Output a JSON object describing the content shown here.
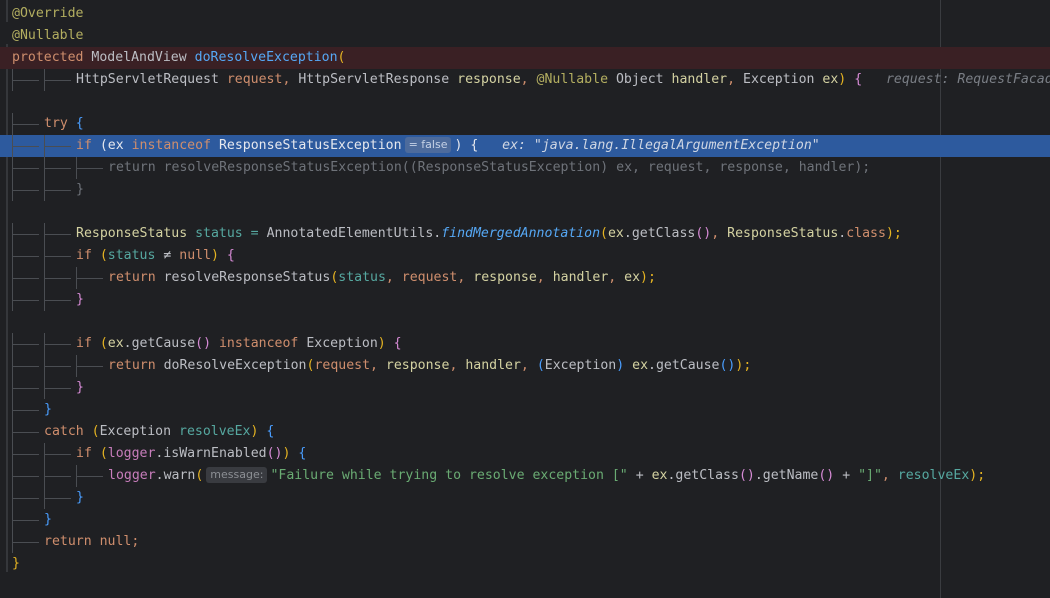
{
  "editor": {
    "lines": [
      {
        "indent": 0,
        "hl": "",
        "tokens": [
          {
            "t": "@Override",
            "c": "ann"
          }
        ]
      },
      {
        "indent": 0,
        "hl": "",
        "tokens": [
          {
            "t": "@Nullable",
            "c": "ann"
          }
        ]
      },
      {
        "indent": 0,
        "hl": "red",
        "tokens": [
          {
            "t": "protected ",
            "c": "kw"
          },
          {
            "t": "ModelAndView ",
            "c": ""
          },
          {
            "t": "doResolveException",
            "c": "fn"
          },
          {
            "t": "(",
            "c": "paren-y"
          }
        ]
      },
      {
        "indent": 2,
        "hl": "",
        "tokens": [
          {
            "t": "HttpServletRequest ",
            "c": ""
          },
          {
            "t": "request",
            "c": "kw"
          },
          {
            "t": ", ",
            "c": "kw"
          },
          {
            "t": "HttpServletResponse ",
            "c": ""
          },
          {
            "t": "response",
            "c": "type"
          },
          {
            "t": ", ",
            "c": "kw"
          },
          {
            "t": "@Nullable ",
            "c": "ann"
          },
          {
            "t": "Object ",
            "c": ""
          },
          {
            "t": "handler",
            "c": "type"
          },
          {
            "t": ", ",
            "c": "kw"
          },
          {
            "t": "Exception ",
            "c": ""
          },
          {
            "t": "ex",
            "c": "type"
          },
          {
            "t": ") ",
            "c": "paren-y"
          },
          {
            "t": "{",
            "c": "paren-p"
          },
          {
            "t": "   request: RequestFacade",
            "c": "hint-val"
          }
        ]
      },
      {
        "indent": 0,
        "hl": "",
        "tokens": []
      },
      {
        "indent": 1,
        "hl": "",
        "tokens": [
          {
            "t": "try ",
            "c": "kw"
          },
          {
            "t": "{",
            "c": "paren-b"
          }
        ]
      },
      {
        "indent": 2,
        "hl": "blue",
        "tokens": [
          {
            "t": "if ",
            "c": "kw"
          },
          {
            "t": "(",
            "c": "paren-y"
          },
          {
            "t": "ex ",
            "c": "type"
          },
          {
            "t": "instanceof ",
            "c": "kw"
          },
          {
            "t": "ResponseStatusException",
            "c": ""
          },
          {
            "inlay": "= false"
          },
          {
            "t": ") ",
            "c": "paren-y"
          },
          {
            "t": "{",
            "c": "paren-p"
          },
          {
            "t": "   ex: \"java.lang.IllegalArgumentException\"",
            "c": "hint-val"
          }
        ]
      },
      {
        "indent": 3,
        "hl": "",
        "tokens": [
          {
            "t": "return resolveResponseStatusException((ResponseStatusException) ex, request, response, handler);",
            "c": "dim"
          }
        ]
      },
      {
        "indent": 2,
        "hl": "",
        "tokens": [
          {
            "t": "}",
            "c": "dim"
          }
        ]
      },
      {
        "indent": 0,
        "hl": "",
        "tokens": []
      },
      {
        "indent": 2,
        "hl": "",
        "tokens": [
          {
            "t": "ResponseStatus ",
            "c": "type"
          },
          {
            "t": "status = ",
            "c": "teal"
          },
          {
            "t": "AnnotatedElementUtils.",
            "c": ""
          },
          {
            "t": "findMergedAnnotation",
            "c": "ital"
          },
          {
            "t": "(",
            "c": "paren-y"
          },
          {
            "t": "ex",
            "c": "type"
          },
          {
            "t": ".getClass",
            "c": ""
          },
          {
            "t": "()",
            "c": "paren-p"
          },
          {
            "t": ", ",
            "c": "kw"
          },
          {
            "t": "ResponseStatus",
            "c": "type"
          },
          {
            "t": ".",
            "c": ""
          },
          {
            "t": "class",
            "c": "kw"
          },
          {
            "t": ");",
            "c": "paren-y"
          }
        ]
      },
      {
        "indent": 2,
        "hl": "",
        "tokens": [
          {
            "t": "if ",
            "c": "kw"
          },
          {
            "t": "(",
            "c": "paren-y"
          },
          {
            "t": "status ",
            "c": "teal"
          },
          {
            "t": "≠ ",
            "c": ""
          },
          {
            "t": "null",
            "c": "kw"
          },
          {
            "t": ") ",
            "c": "paren-y"
          },
          {
            "t": "{",
            "c": "paren-p"
          }
        ]
      },
      {
        "indent": 3,
        "hl": "",
        "tokens": [
          {
            "t": "return ",
            "c": "kw"
          },
          {
            "t": "resolveResponseStatus",
            "c": ""
          },
          {
            "t": "(",
            "c": "paren-y"
          },
          {
            "t": "status",
            "c": "teal"
          },
          {
            "t": ", ",
            "c": "kw"
          },
          {
            "t": "request",
            "c": "kw"
          },
          {
            "t": ", ",
            "c": "kw"
          },
          {
            "t": "response",
            "c": "type"
          },
          {
            "t": ", ",
            "c": "kw"
          },
          {
            "t": "handler",
            "c": "type"
          },
          {
            "t": ", ",
            "c": "kw"
          },
          {
            "t": "ex",
            "c": "type"
          },
          {
            "t": ");",
            "c": "paren-y"
          }
        ]
      },
      {
        "indent": 2,
        "hl": "",
        "tokens": [
          {
            "t": "}",
            "c": "paren-p"
          }
        ]
      },
      {
        "indent": 0,
        "hl": "",
        "tokens": []
      },
      {
        "indent": 2,
        "hl": "",
        "tokens": [
          {
            "t": "if ",
            "c": "kw"
          },
          {
            "t": "(",
            "c": "paren-y"
          },
          {
            "t": "ex",
            "c": "type"
          },
          {
            "t": ".getCause",
            "c": ""
          },
          {
            "t": "() ",
            "c": "paren-p"
          },
          {
            "t": "instanceof ",
            "c": "kw"
          },
          {
            "t": "Exception",
            "c": ""
          },
          {
            "t": ") ",
            "c": "paren-y"
          },
          {
            "t": "{",
            "c": "paren-p"
          }
        ]
      },
      {
        "indent": 3,
        "hl": "",
        "tokens": [
          {
            "t": "return ",
            "c": "kw"
          },
          {
            "t": "doResolveException",
            "c": ""
          },
          {
            "t": "(",
            "c": "paren-y"
          },
          {
            "t": "request",
            "c": "kw"
          },
          {
            "t": ", ",
            "c": "kw"
          },
          {
            "t": "response",
            "c": "type"
          },
          {
            "t": ", ",
            "c": "kw"
          },
          {
            "t": "handler",
            "c": "type"
          },
          {
            "t": ", ",
            "c": "kw"
          },
          {
            "t": "(",
            "c": "paren-b"
          },
          {
            "t": "Exception",
            "c": ""
          },
          {
            "t": ") ",
            "c": "paren-b"
          },
          {
            "t": "ex",
            "c": "type"
          },
          {
            "t": ".getCause",
            "c": ""
          },
          {
            "t": "()",
            "c": "paren-b"
          },
          {
            "t": ");",
            "c": "paren-y"
          }
        ]
      },
      {
        "indent": 2,
        "hl": "",
        "tokens": [
          {
            "t": "}",
            "c": "paren-p"
          }
        ]
      },
      {
        "indent": 1,
        "hl": "",
        "tokens": [
          {
            "t": "}",
            "c": "paren-b"
          }
        ]
      },
      {
        "indent": 1,
        "hl": "",
        "tokens": [
          {
            "t": "catch ",
            "c": "kw"
          },
          {
            "t": "(",
            "c": "paren-y"
          },
          {
            "t": "Exception ",
            "c": ""
          },
          {
            "t": "resolveEx",
            "c": "teal"
          },
          {
            "t": ") ",
            "c": "paren-y"
          },
          {
            "t": "{",
            "c": "paren-b"
          }
        ]
      },
      {
        "indent": 2,
        "hl": "",
        "tokens": [
          {
            "t": "if ",
            "c": "kw"
          },
          {
            "t": "(",
            "c": "paren-y"
          },
          {
            "t": "logger",
            "c": "field"
          },
          {
            "t": ".isWarnEnabled",
            "c": ""
          },
          {
            "t": "()",
            "c": "paren-p"
          },
          {
            "t": ") ",
            "c": "paren-y"
          },
          {
            "t": "{",
            "c": "paren-b"
          }
        ]
      },
      {
        "indent": 3,
        "hl": "",
        "tokens": [
          {
            "t": "logger",
            "c": "field"
          },
          {
            "t": ".warn",
            "c": ""
          },
          {
            "t": "(",
            "c": "paren-y"
          },
          {
            "inlay": "message:"
          },
          {
            "t": "\"Failure while trying to resolve exception [\" ",
            "c": "str"
          },
          {
            "t": "+ ",
            "c": ""
          },
          {
            "t": "ex",
            "c": "type"
          },
          {
            "t": ".getClass",
            "c": ""
          },
          {
            "t": "()",
            "c": "paren-p"
          },
          {
            "t": ".getName",
            "c": ""
          },
          {
            "t": "() ",
            "c": "paren-p"
          },
          {
            "t": "+ ",
            "c": ""
          },
          {
            "t": "\"]\"",
            "c": "str"
          },
          {
            "t": ", ",
            "c": "kw"
          },
          {
            "t": "resolveEx",
            "c": "teal"
          },
          {
            "t": ");",
            "c": "paren-y"
          }
        ]
      },
      {
        "indent": 2,
        "hl": "",
        "tokens": [
          {
            "t": "}",
            "c": "paren-b"
          }
        ]
      },
      {
        "indent": 1,
        "hl": "",
        "tokens": [
          {
            "t": "}",
            "c": "paren-b"
          }
        ]
      },
      {
        "indent": 1,
        "hl": "",
        "tokens": [
          {
            "t": "return ",
            "c": "kw"
          },
          {
            "t": "null",
            "c": "kw"
          },
          {
            "t": ";",
            "c": "kw"
          }
        ]
      },
      {
        "indent": 0,
        "hl": "",
        "tokens": [
          {
            "t": "}",
            "c": "paren-y"
          }
        ]
      }
    ]
  }
}
